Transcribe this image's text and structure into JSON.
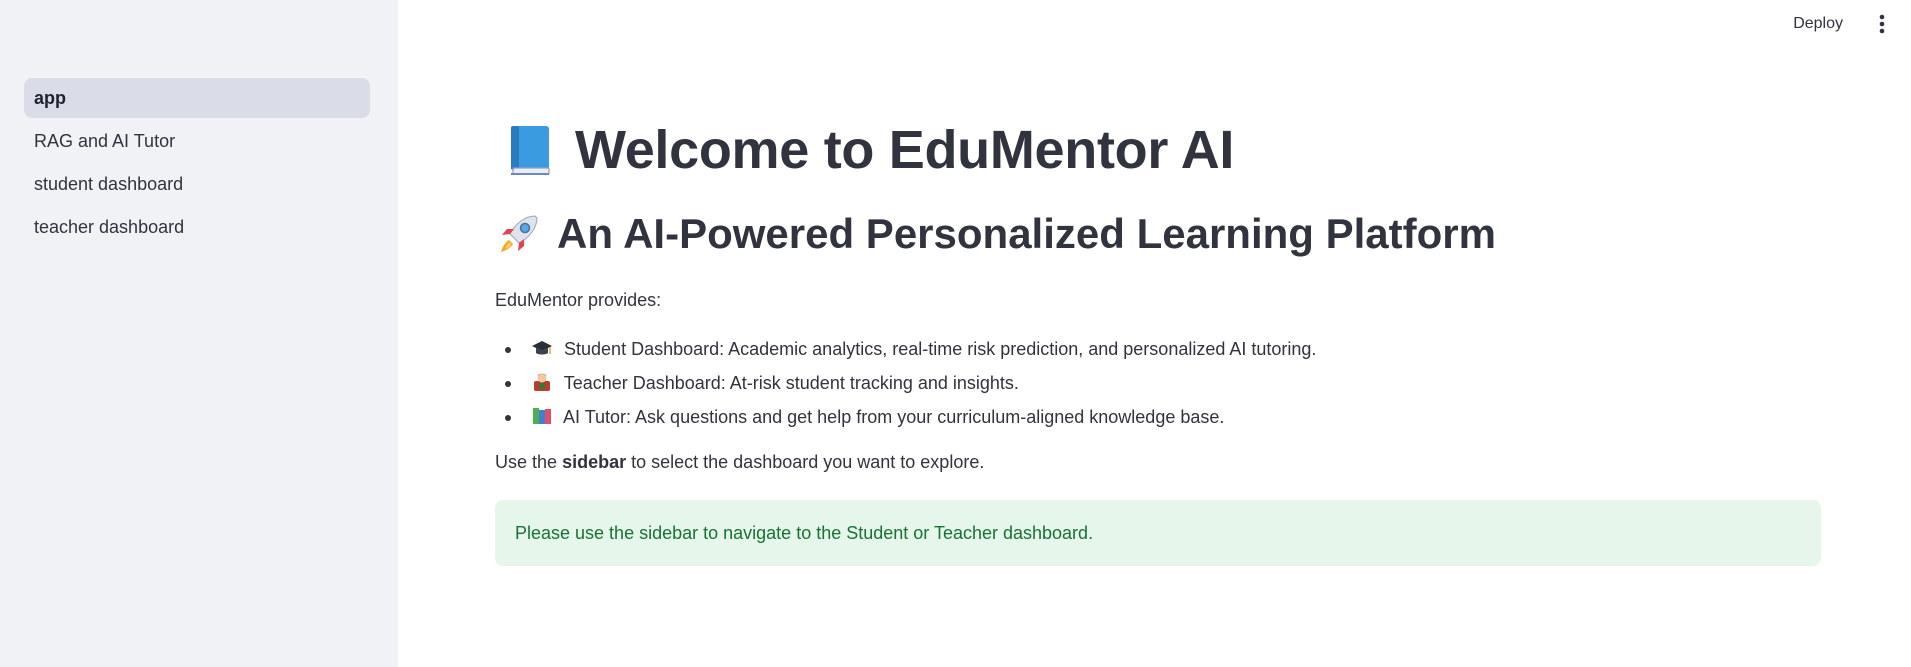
{
  "sidebar": {
    "items": [
      {
        "label": "app",
        "active": true
      },
      {
        "label": "RAG and AI Tutor",
        "active": false
      },
      {
        "label": "student dashboard",
        "active": false
      },
      {
        "label": "teacher dashboard",
        "active": false
      }
    ]
  },
  "header": {
    "deploy_label": "Deploy",
    "menu_icon": "vertical-dots-icon"
  },
  "main": {
    "title_icon": "blue-book-icon",
    "title": "Welcome to EduMentor AI",
    "subtitle_icon": "rocket-icon",
    "subtitle": "An AI-Powered Personalized Learning Platform",
    "intro": "EduMentor provides:",
    "features": [
      {
        "icon": "graduation-cap-icon",
        "text": "Student Dashboard: Academic analytics, real-time risk prediction, and personalized AI tutoring."
      },
      {
        "icon": "teacher-icon",
        "text": "Teacher Dashboard: At-risk student tracking and insights."
      },
      {
        "icon": "books-icon",
        "text": "AI Tutor: Ask questions and get help from your curriculum-aligned knowledge base."
      }
    ],
    "usage_prefix": "Use the",
    "usage_bold": "sidebar",
    "usage_suffix": "to select the dashboard you want to explore.",
    "alert": "Please use the sidebar to navigate to the Student or Teacher dashboard."
  },
  "colors": {
    "sidebar_bg": "#f0f2f6",
    "active_item_bg": "#dadde7",
    "text": "#31333f",
    "alert_bg": "#e6f6ea",
    "alert_text": "#177233"
  }
}
